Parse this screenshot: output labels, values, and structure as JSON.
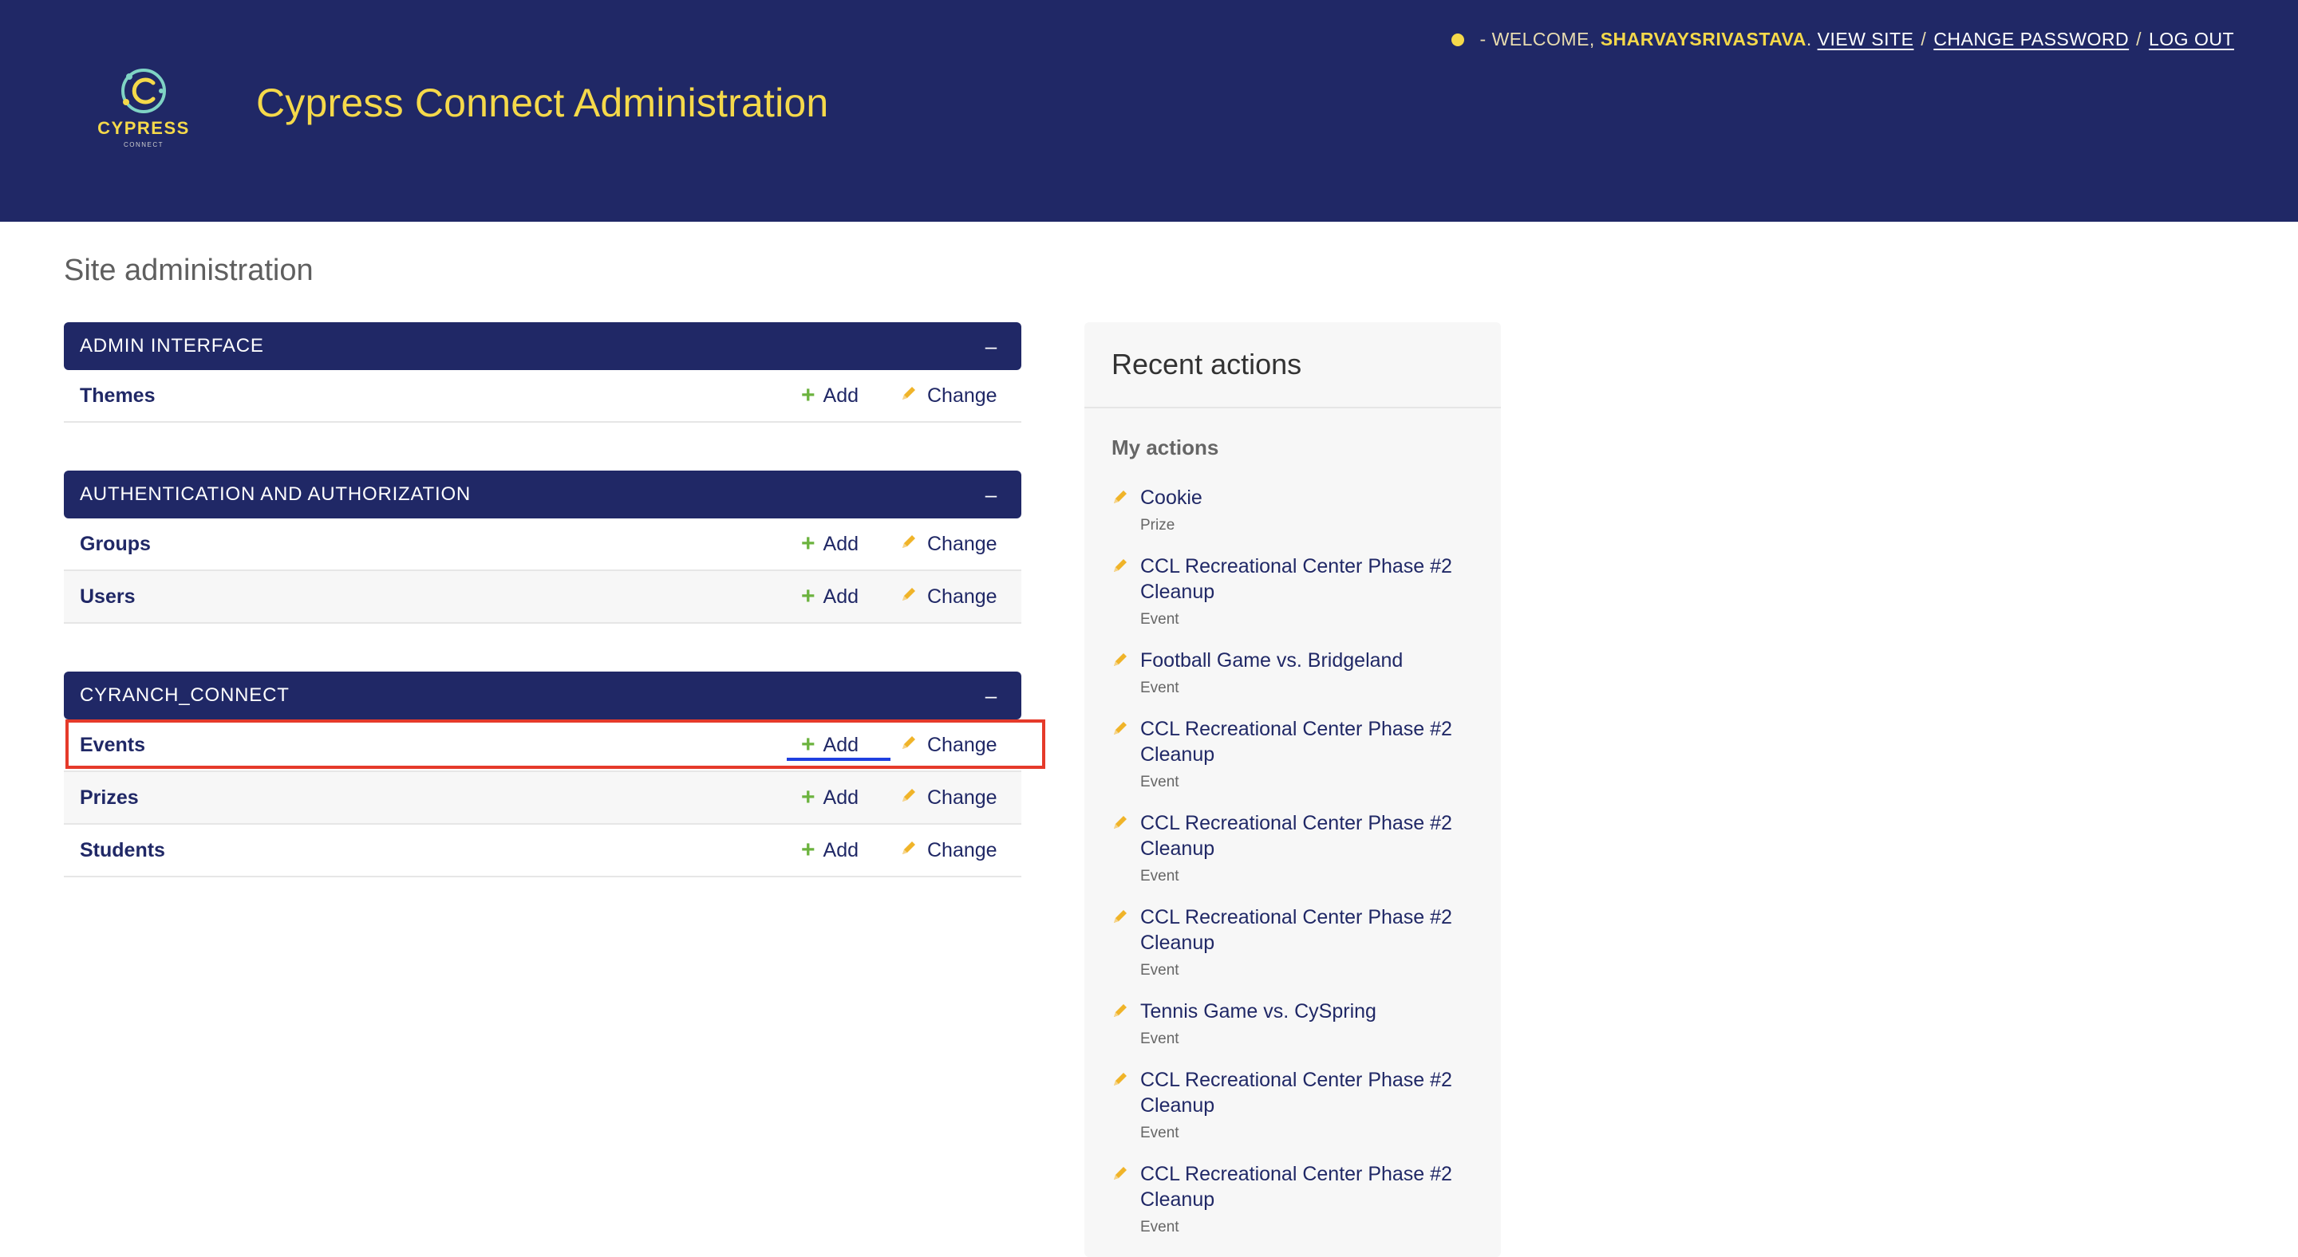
{
  "header": {
    "logo_text": "CYPRESS",
    "logo_subtext": "CONNECT",
    "title": "Cypress Connect Administration",
    "welcome_prefix": "- WELCOME,",
    "username": "SHARVAYSRIVASTAVA",
    "username_suffix": ".",
    "links": {
      "view_site": "VIEW SITE",
      "change_password": "CHANGE PASSWORD",
      "log_out": "LOG OUT"
    },
    "separator": "/",
    "brand_color": "#202866",
    "accent_color": "#f5d94a"
  },
  "page": {
    "title": "Site administration"
  },
  "modules": [
    {
      "caption": "ADMIN INTERFACE",
      "collapse_label": "–",
      "models": [
        {
          "name": "Themes",
          "add": "Add",
          "change": "Change"
        }
      ]
    },
    {
      "caption": "AUTHENTICATION AND AUTHORIZATION",
      "collapse_label": "–",
      "models": [
        {
          "name": "Groups",
          "add": "Add",
          "change": "Change"
        },
        {
          "name": "Users",
          "add": "Add",
          "change": "Change"
        }
      ]
    },
    {
      "caption": "CYRANCH_CONNECT",
      "collapse_label": "–",
      "models": [
        {
          "name": "Events",
          "add": "Add",
          "change": "Change"
        },
        {
          "name": "Prizes",
          "add": "Add",
          "change": "Change"
        },
        {
          "name": "Students",
          "add": "Add",
          "change": "Change"
        }
      ]
    }
  ],
  "recent_actions": {
    "title": "Recent actions",
    "subtitle": "My actions",
    "items": [
      {
        "title": "Cookie",
        "type": "Prize"
      },
      {
        "title": "CCL Recreational Center Phase #2 Cleanup",
        "type": "Event"
      },
      {
        "title": "Football Game vs. Bridgeland",
        "type": "Event"
      },
      {
        "title": "CCL Recreational Center Phase #2 Cleanup",
        "type": "Event"
      },
      {
        "title": "CCL Recreational Center Phase #2 Cleanup",
        "type": "Event"
      },
      {
        "title": "CCL Recreational Center Phase #2 Cleanup",
        "type": "Event"
      },
      {
        "title": "Tennis Game vs. CySpring",
        "type": "Event"
      },
      {
        "title": "CCL Recreational Center Phase #2 Cleanup",
        "type": "Event"
      },
      {
        "title": "CCL Recreational Center Phase #2 Cleanup",
        "type": "Event"
      }
    ]
  },
  "icons": {
    "add": "plus-icon",
    "change": "pencil-icon",
    "status": "status-dot-icon",
    "logo": "cypress-logo"
  },
  "annotations": {
    "highlight_color": "#e53a2a",
    "underline_color": "#1f3fe0"
  }
}
